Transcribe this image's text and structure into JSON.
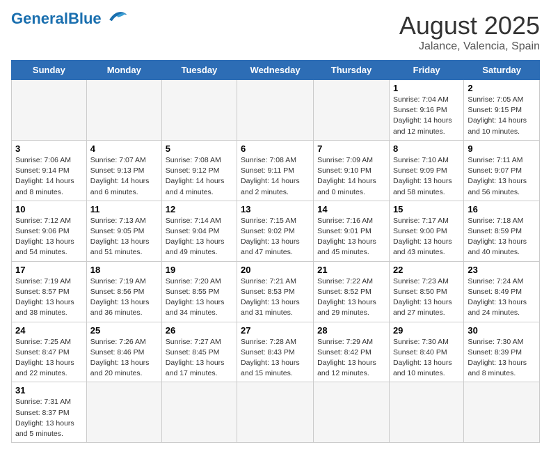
{
  "header": {
    "logo_general": "General",
    "logo_blue": "Blue",
    "month_year": "August 2025",
    "location": "Jalance, Valencia, Spain"
  },
  "days_of_week": [
    "Sunday",
    "Monday",
    "Tuesday",
    "Wednesday",
    "Thursday",
    "Friday",
    "Saturday"
  ],
  "weeks": [
    {
      "days": [
        {
          "number": "",
          "info": "",
          "empty": true
        },
        {
          "number": "",
          "info": "",
          "empty": true
        },
        {
          "number": "",
          "info": "",
          "empty": true
        },
        {
          "number": "",
          "info": "",
          "empty": true
        },
        {
          "number": "",
          "info": "",
          "empty": true
        },
        {
          "number": "1",
          "info": "Sunrise: 7:04 AM\nSunset: 9:16 PM\nDaylight: 14 hours\nand 12 minutes."
        },
        {
          "number": "2",
          "info": "Sunrise: 7:05 AM\nSunset: 9:15 PM\nDaylight: 14 hours\nand 10 minutes."
        }
      ]
    },
    {
      "days": [
        {
          "number": "3",
          "info": "Sunrise: 7:06 AM\nSunset: 9:14 PM\nDaylight: 14 hours\nand 8 minutes."
        },
        {
          "number": "4",
          "info": "Sunrise: 7:07 AM\nSunset: 9:13 PM\nDaylight: 14 hours\nand 6 minutes."
        },
        {
          "number": "5",
          "info": "Sunrise: 7:08 AM\nSunset: 9:12 PM\nDaylight: 14 hours\nand 4 minutes."
        },
        {
          "number": "6",
          "info": "Sunrise: 7:08 AM\nSunset: 9:11 PM\nDaylight: 14 hours\nand 2 minutes."
        },
        {
          "number": "7",
          "info": "Sunrise: 7:09 AM\nSunset: 9:10 PM\nDaylight: 14 hours\nand 0 minutes."
        },
        {
          "number": "8",
          "info": "Sunrise: 7:10 AM\nSunset: 9:09 PM\nDaylight: 13 hours\nand 58 minutes."
        },
        {
          "number": "9",
          "info": "Sunrise: 7:11 AM\nSunset: 9:07 PM\nDaylight: 13 hours\nand 56 minutes."
        }
      ]
    },
    {
      "days": [
        {
          "number": "10",
          "info": "Sunrise: 7:12 AM\nSunset: 9:06 PM\nDaylight: 13 hours\nand 54 minutes."
        },
        {
          "number": "11",
          "info": "Sunrise: 7:13 AM\nSunset: 9:05 PM\nDaylight: 13 hours\nand 51 minutes."
        },
        {
          "number": "12",
          "info": "Sunrise: 7:14 AM\nSunset: 9:04 PM\nDaylight: 13 hours\nand 49 minutes."
        },
        {
          "number": "13",
          "info": "Sunrise: 7:15 AM\nSunset: 9:02 PM\nDaylight: 13 hours\nand 47 minutes."
        },
        {
          "number": "14",
          "info": "Sunrise: 7:16 AM\nSunset: 9:01 PM\nDaylight: 13 hours\nand 45 minutes."
        },
        {
          "number": "15",
          "info": "Sunrise: 7:17 AM\nSunset: 9:00 PM\nDaylight: 13 hours\nand 43 minutes."
        },
        {
          "number": "16",
          "info": "Sunrise: 7:18 AM\nSunset: 8:59 PM\nDaylight: 13 hours\nand 40 minutes."
        }
      ]
    },
    {
      "days": [
        {
          "number": "17",
          "info": "Sunrise: 7:19 AM\nSunset: 8:57 PM\nDaylight: 13 hours\nand 38 minutes."
        },
        {
          "number": "18",
          "info": "Sunrise: 7:19 AM\nSunset: 8:56 PM\nDaylight: 13 hours\nand 36 minutes."
        },
        {
          "number": "19",
          "info": "Sunrise: 7:20 AM\nSunset: 8:55 PM\nDaylight: 13 hours\nand 34 minutes."
        },
        {
          "number": "20",
          "info": "Sunrise: 7:21 AM\nSunset: 8:53 PM\nDaylight: 13 hours\nand 31 minutes."
        },
        {
          "number": "21",
          "info": "Sunrise: 7:22 AM\nSunset: 8:52 PM\nDaylight: 13 hours\nand 29 minutes."
        },
        {
          "number": "22",
          "info": "Sunrise: 7:23 AM\nSunset: 8:50 PM\nDaylight: 13 hours\nand 27 minutes."
        },
        {
          "number": "23",
          "info": "Sunrise: 7:24 AM\nSunset: 8:49 PM\nDaylight: 13 hours\nand 24 minutes."
        }
      ]
    },
    {
      "days": [
        {
          "number": "24",
          "info": "Sunrise: 7:25 AM\nSunset: 8:47 PM\nDaylight: 13 hours\nand 22 minutes."
        },
        {
          "number": "25",
          "info": "Sunrise: 7:26 AM\nSunset: 8:46 PM\nDaylight: 13 hours\nand 20 minutes."
        },
        {
          "number": "26",
          "info": "Sunrise: 7:27 AM\nSunset: 8:45 PM\nDaylight: 13 hours\nand 17 minutes."
        },
        {
          "number": "27",
          "info": "Sunrise: 7:28 AM\nSunset: 8:43 PM\nDaylight: 13 hours\nand 15 minutes."
        },
        {
          "number": "28",
          "info": "Sunrise: 7:29 AM\nSunset: 8:42 PM\nDaylight: 13 hours\nand 12 minutes."
        },
        {
          "number": "29",
          "info": "Sunrise: 7:30 AM\nSunset: 8:40 PM\nDaylight: 13 hours\nand 10 minutes."
        },
        {
          "number": "30",
          "info": "Sunrise: 7:30 AM\nSunset: 8:39 PM\nDaylight: 13 hours\nand 8 minutes."
        }
      ]
    },
    {
      "days": [
        {
          "number": "31",
          "info": "Sunrise: 7:31 AM\nSunset: 8:37 PM\nDaylight: 13 hours\nand 5 minutes."
        },
        {
          "number": "",
          "info": "",
          "empty": true
        },
        {
          "number": "",
          "info": "",
          "empty": true
        },
        {
          "number": "",
          "info": "",
          "empty": true
        },
        {
          "number": "",
          "info": "",
          "empty": true
        },
        {
          "number": "",
          "info": "",
          "empty": true
        },
        {
          "number": "",
          "info": "",
          "empty": true
        }
      ]
    }
  ]
}
